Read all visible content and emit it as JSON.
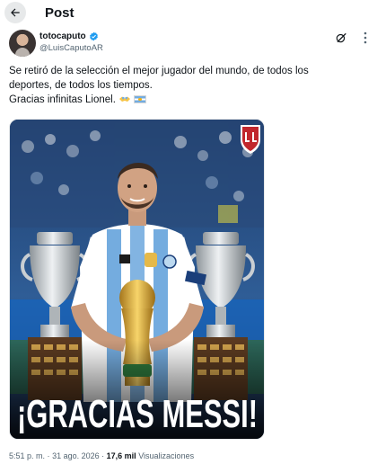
{
  "header": {
    "back_icon": "arrow-left-icon",
    "title": "Post"
  },
  "author": {
    "display_name": "totocaputo",
    "handle": "@LuisCaputoAR",
    "verified_icon": "verified-badge-icon",
    "grok_icon": "grok-icon",
    "more_icon": "more-vertical-icon"
  },
  "tweet": {
    "line1": "Se retiró de la selección el mejor jugador del mundo, de todos los",
    "line2": "deportes, de todos los tiempos.",
    "line3": "Gracias infinitas Lionel.",
    "emojis": [
      "handshake-hearts-emoji",
      "argentina-flag-emoji"
    ]
  },
  "media": {
    "caption": "¡GRACIAS MESSI!",
    "logo_icon": "club-shield-logo-icon"
  },
  "meta": {
    "time": "5:51 p. m.",
    "separator": "·",
    "date": "31 ago. 2026",
    "views_count": "17,6 mil",
    "views_label": "Visualizaciones"
  },
  "colors": {
    "text": "#0f1419",
    "secondary": "#536471",
    "verified": "#1d9bf0",
    "argentina_blue": "#74acdf"
  }
}
